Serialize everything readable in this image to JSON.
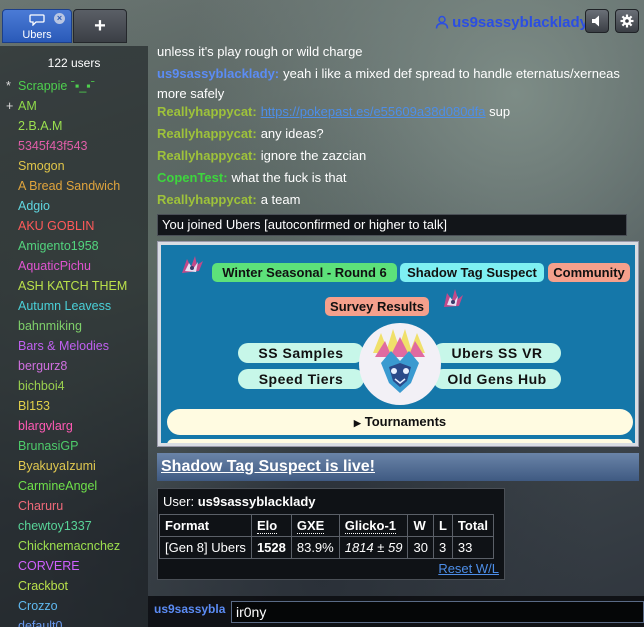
{
  "header": {
    "room_tab_label": "Ubers",
    "room_tab_close": "×",
    "new_tab_label": "+",
    "username": "us9sassyblacklady"
  },
  "userlist": {
    "count_label": "122 users",
    "users": [
      {
        "rank": "*",
        "name": "Scrappie ˉ▪_▪ˉ",
        "color": "#4ed04e"
      },
      {
        "rank": "+",
        "name": "AM",
        "color": "#8fd94a"
      },
      {
        "rank": "",
        "name": "2.B.A.M",
        "color": "#9be04f"
      },
      {
        "rank": "",
        "name": "5345f43f543",
        "color": "#e05ea8"
      },
      {
        "rank": "",
        "name": "Smogon",
        "color": "#e0c64a"
      },
      {
        "rank": "",
        "name": "A Bread Sandwich",
        "color": "#e0a43c"
      },
      {
        "rank": "",
        "name": "Adgio",
        "color": "#5fd6e0"
      },
      {
        "rank": "",
        "name": "AKU GOBLIN",
        "color": "#ff5a5a"
      },
      {
        "rank": "",
        "name": "Amigento1958",
        "color": "#52d47e"
      },
      {
        "rank": "",
        "name": "AquaticPichu",
        "color": "#e054d0"
      },
      {
        "rank": "",
        "name": "ASH KATCH THEM",
        "color": "#b9e04a"
      },
      {
        "rank": "",
        "name": "Autumn Leavess",
        "color": "#4ad0d8"
      },
      {
        "rank": "",
        "name": "bahnmiking",
        "color": "#7fd06a"
      },
      {
        "rank": "",
        "name": "Bars & Melodies",
        "color": "#c060f0"
      },
      {
        "rank": "",
        "name": "bergurz8",
        "color": "#d070e0"
      },
      {
        "rank": "",
        "name": "bichboi4",
        "color": "#9ad04e"
      },
      {
        "rank": "",
        "name": "Bl153",
        "color": "#e0d04a"
      },
      {
        "rank": "",
        "name": "blargvlarg",
        "color": "#ff5ab4"
      },
      {
        "rank": "",
        "name": "BrunasiGP",
        "color": "#4ecc6a"
      },
      {
        "rank": "",
        "name": "ByakuyaIzumi",
        "color": "#e0c850"
      },
      {
        "rank": "",
        "name": "CarmineAngel",
        "color": "#6fe04a"
      },
      {
        "rank": "",
        "name": "Charuru",
        "color": "#f06a7a"
      },
      {
        "rank": "",
        "name": "chewtoy1337",
        "color": "#58d498"
      },
      {
        "rank": "",
        "name": "Chicknemacnchez",
        "color": "#9ee04e"
      },
      {
        "rank": "",
        "name": "CORVERE",
        "color": "#d060ff"
      },
      {
        "rank": "",
        "name": "Crackbot",
        "color": "#b8e04a"
      },
      {
        "rank": "",
        "name": "Crozzo",
        "color": "#5fb8f0"
      },
      {
        "rank": "",
        "name": "default0",
        "color": "#6a9af0"
      }
    ]
  },
  "chat": {
    "messages": [
      {
        "user": "",
        "text": "unless it's play rough or wild charge",
        "user_color": "#ffffff"
      },
      {
        "user": "us9sassyblacklady:",
        "text": "yeah i like a mixed def spread to handle eternatus/xerneas more safely",
        "user_color": "#5b8cf5"
      },
      {
        "user": "Reallyhappycat:",
        "text": "https://pokepast.es/e55609a38d080dfa",
        "text2": " sup",
        "link": true,
        "user_color": "#9ec23a"
      },
      {
        "user": "Reallyhappycat:",
        "text": "any ideas?",
        "user_color": "#9ec23a"
      },
      {
        "user": "Reallyhappycat:",
        "text": "ignore the zazcian",
        "user_color": "#9ec23a"
      },
      {
        "user": "CopenTest:",
        "text": "what the fuck is that",
        "user_color": "#3dd63d"
      },
      {
        "user": "Reallyhappycat:",
        "text": "a team",
        "user_color": "#9ec23a"
      }
    ],
    "notice": "You joined Ubers [autoconfirmed or higher to talk]",
    "banner": {
      "pill1": "Winter Seasonal - Round 6",
      "pill2": "Shadow Tag Suspect",
      "pill3": "Community",
      "pill4": "Survey Results",
      "btn_samples": "SS Samples",
      "btn_vr": "Ubers SS VR",
      "btn_speed": "Speed Tiers",
      "btn_oldgens": "Old Gens Hub",
      "tournaments": "Tournaments"
    },
    "announcement": "Shadow Tag Suspect is live!",
    "rating": {
      "user_label": "User:",
      "user_name": "us9sassyblacklady",
      "headers": [
        "Format",
        "Elo",
        "GXE",
        "Glicko-1",
        "W",
        "L",
        "Total"
      ],
      "row": {
        "format": "[Gen 8] Ubers",
        "elo": "1528",
        "gxe": "83.9%",
        "glicko": "1814 ± 59",
        "w": "30",
        "l": "3",
        "total": "33"
      },
      "reset": "Reset W/L"
    }
  },
  "chatbox": {
    "name": "us9sassybla",
    "value": "ir0ny"
  }
}
